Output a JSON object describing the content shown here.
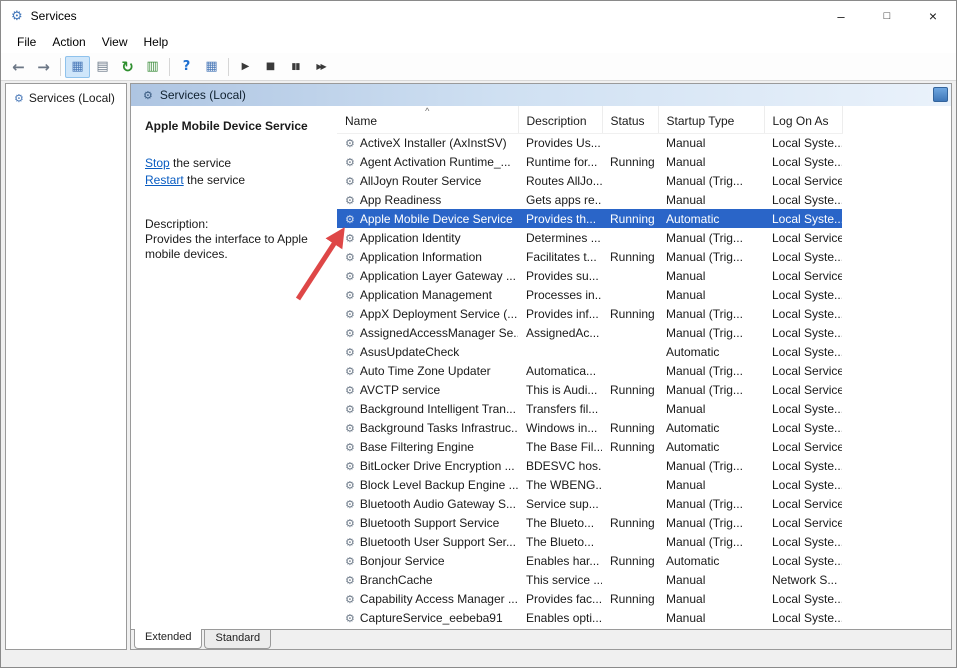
{
  "window": {
    "title": "Services",
    "controls": {
      "minimize": "–",
      "maximize": "□",
      "close": "×"
    }
  },
  "menubar": {
    "items": [
      "File",
      "Action",
      "View",
      "Help"
    ]
  },
  "toolbar": {
    "icon_names": [
      "back",
      "forward",
      "show-console-tree",
      "show-action-pane",
      "refresh",
      "export-list",
      "help",
      "properties",
      "start-service",
      "stop-service",
      "pause-service",
      "restart-service"
    ]
  },
  "icons": {
    "gear": "⚙",
    "back": "←",
    "forward": "→",
    "console_tree": "▦",
    "action_pane": "▤",
    "refresh": "↻",
    "export_list": "▥",
    "help": "?",
    "properties": "▦",
    "play": "▶",
    "stop": "■",
    "pause": "▮▮",
    "restart": "▶▶",
    "sort_ascending": "^"
  },
  "tree": {
    "root_label": "Services (Local)"
  },
  "banner": {
    "title": "Services (Local)"
  },
  "info_panel": {
    "service_title": "Apple Mobile Device Service",
    "stop_link": "Stop",
    "stop_rest": " the service",
    "restart_link": "Restart",
    "restart_rest": " the service",
    "description_label": "Description:",
    "description_text": "Provides the interface to Apple mobile devices."
  },
  "table": {
    "columns": [
      "Name",
      "Description",
      "Status",
      "Startup Type",
      "Log On As"
    ],
    "rows": [
      {
        "name": "ActiveX Installer (AxInstSV)",
        "description": "Provides Us...",
        "status": "",
        "startup": "Manual",
        "logon": "Local Syste...",
        "selected": false
      },
      {
        "name": "Agent Activation Runtime_...",
        "description": "Runtime for...",
        "status": "Running",
        "startup": "Manual",
        "logon": "Local Syste...",
        "selected": false
      },
      {
        "name": "AllJoyn Router Service",
        "description": "Routes AllJo...",
        "status": "",
        "startup": "Manual (Trig...",
        "logon": "Local Service",
        "selected": false
      },
      {
        "name": "App Readiness",
        "description": "Gets apps re...",
        "status": "",
        "startup": "Manual",
        "logon": "Local Syste...",
        "selected": false
      },
      {
        "name": "Apple Mobile Device Service",
        "description": "Provides th...",
        "status": "Running",
        "startup": "Automatic",
        "logon": "Local Syste...",
        "selected": true
      },
      {
        "name": "Application Identity",
        "description": "Determines ...",
        "status": "",
        "startup": "Manual (Trig...",
        "logon": "Local Service",
        "selected": false
      },
      {
        "name": "Application Information",
        "description": "Facilitates t...",
        "status": "Running",
        "startup": "Manual (Trig...",
        "logon": "Local Syste...",
        "selected": false
      },
      {
        "name": "Application Layer Gateway ...",
        "description": "Provides su...",
        "status": "",
        "startup": "Manual",
        "logon": "Local Service",
        "selected": false
      },
      {
        "name": "Application Management",
        "description": "Processes in...",
        "status": "",
        "startup": "Manual",
        "logon": "Local Syste...",
        "selected": false
      },
      {
        "name": "AppX Deployment Service (...",
        "description": "Provides inf...",
        "status": "Running",
        "startup": "Manual (Trig...",
        "logon": "Local Syste...",
        "selected": false
      },
      {
        "name": "AssignedAccessManager Se...",
        "description": "AssignedAc...",
        "status": "",
        "startup": "Manual (Trig...",
        "logon": "Local Syste...",
        "selected": false
      },
      {
        "name": "AsusUpdateCheck",
        "description": "",
        "status": "",
        "startup": "Automatic",
        "logon": "Local Syste...",
        "selected": false
      },
      {
        "name": "Auto Time Zone Updater",
        "description": "Automatica...",
        "status": "",
        "startup": "Manual (Trig...",
        "logon": "Local Service",
        "selected": false
      },
      {
        "name": "AVCTP service",
        "description": "This is Audi...",
        "status": "Running",
        "startup": "Manual (Trig...",
        "logon": "Local Service",
        "selected": false
      },
      {
        "name": "Background Intelligent Tran...",
        "description": "Transfers fil...",
        "status": "",
        "startup": "Manual",
        "logon": "Local Syste...",
        "selected": false
      },
      {
        "name": "Background Tasks Infrastruc...",
        "description": "Windows in...",
        "status": "Running",
        "startup": "Automatic",
        "logon": "Local Syste...",
        "selected": false
      },
      {
        "name": "Base Filtering Engine",
        "description": "The Base Fil...",
        "status": "Running",
        "startup": "Automatic",
        "logon": "Local Service",
        "selected": false
      },
      {
        "name": "BitLocker Drive Encryption ...",
        "description": "BDESVC hos...",
        "status": "",
        "startup": "Manual (Trig...",
        "logon": "Local Syste...",
        "selected": false
      },
      {
        "name": "Block Level Backup Engine ...",
        "description": "The WBENG...",
        "status": "",
        "startup": "Manual",
        "logon": "Local Syste...",
        "selected": false
      },
      {
        "name": "Bluetooth Audio Gateway S...",
        "description": "Service sup...",
        "status": "",
        "startup": "Manual (Trig...",
        "logon": "Local Service",
        "selected": false
      },
      {
        "name": "Bluetooth Support Service",
        "description": "The Blueto...",
        "status": "Running",
        "startup": "Manual (Trig...",
        "logon": "Local Service",
        "selected": false
      },
      {
        "name": "Bluetooth User Support Ser...",
        "description": "The Blueto...",
        "status": "",
        "startup": "Manual (Trig...",
        "logon": "Local Syste...",
        "selected": false
      },
      {
        "name": "Bonjour Service",
        "description": "Enables har...",
        "status": "Running",
        "startup": "Automatic",
        "logon": "Local Syste...",
        "selected": false
      },
      {
        "name": "BranchCache",
        "description": "This service ...",
        "status": "",
        "startup": "Manual",
        "logon": "Network S...",
        "selected": false
      },
      {
        "name": "Capability Access Manager ...",
        "description": "Provides fac...",
        "status": "Running",
        "startup": "Manual",
        "logon": "Local Syste...",
        "selected": false
      },
      {
        "name": "CaptureService_eebeba91",
        "description": "Enables opti...",
        "status": "",
        "startup": "Manual",
        "logon": "Local Syste...",
        "selected": false
      }
    ]
  },
  "tabs": {
    "extended": "Extended",
    "standard": "Standard",
    "active": "Extended"
  },
  "colors": {
    "selection": "#2a65c8",
    "link": "#0a5dc2",
    "annotation_arrow": "#de4747"
  }
}
